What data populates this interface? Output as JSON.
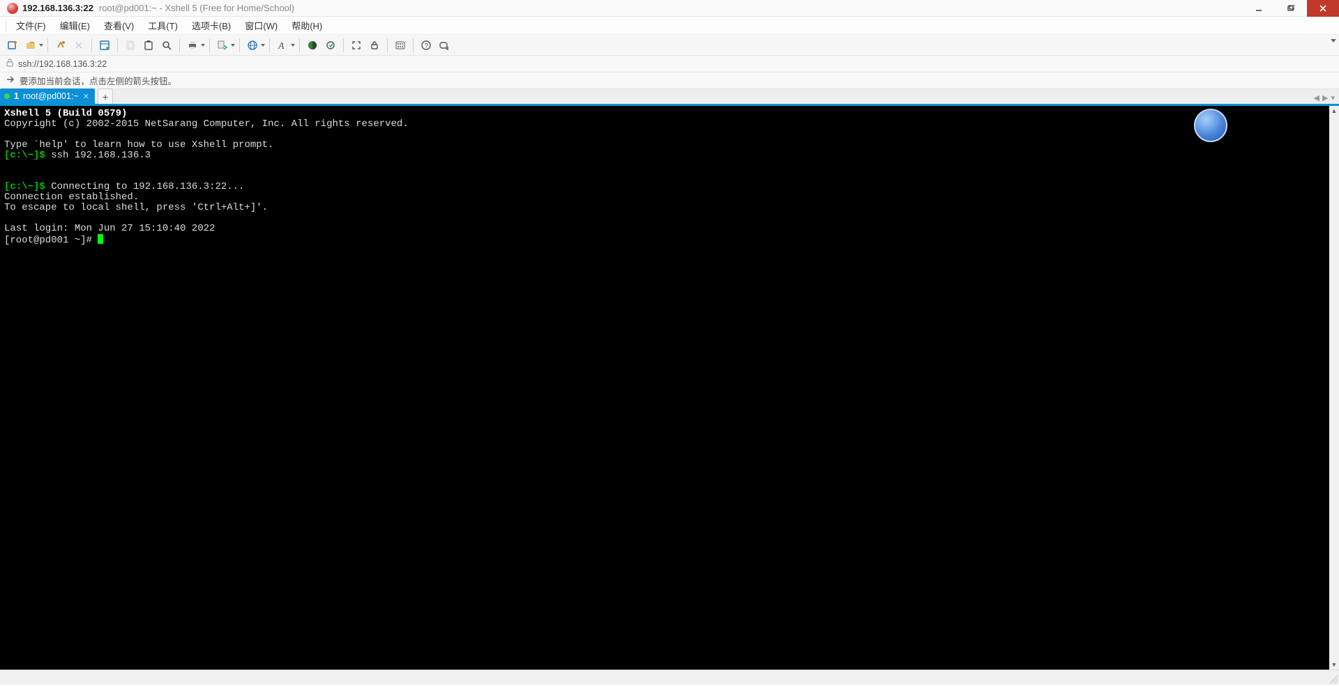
{
  "title": {
    "primary": "192.168.136.3:22",
    "secondary": "root@pd001:~ - Xshell 5 (Free for Home/School)"
  },
  "menu": {
    "file": "文件(F)",
    "edit": "编辑(E)",
    "view": "查看(V)",
    "tools": "工具(T)",
    "tabs": "选项卡(B)",
    "window": "窗口(W)",
    "help": "帮助(H)"
  },
  "toolbar_icons": {
    "new_session": "new-session-icon",
    "open": "open-icon",
    "reconnect": "reconnect-icon",
    "disconnect": "disconnect-icon",
    "properties": "properties-icon",
    "copy": "copy-icon",
    "paste": "paste-icon",
    "find": "find-icon",
    "print": "print-icon",
    "file_transfer": "file-transfer-icon",
    "encoding": "encoding-icon",
    "font": "font-icon",
    "color_scheme": "color-scheme-icon",
    "highlight": "highlight-icon",
    "fullscreen": "fullscreen-icon",
    "lock": "lock-icon",
    "keypad": "keypad-icon",
    "help": "help-icon",
    "compose": "compose-icon"
  },
  "address_bar": {
    "url": "ssh://192.168.136.3:22"
  },
  "info_bar": {
    "hint": "要添加当前会话，点击左侧的箭头按钮。"
  },
  "tab": {
    "index": "1",
    "label": "root@pd001:~",
    "add": "+"
  },
  "terminal": {
    "line_build": "Xshell 5 (Build 0579)",
    "line_copyright": "Copyright (c) 2002-2015 NetSarang Computer, Inc. All rights reserved.",
    "line_blank": "",
    "line_help": "Type `help' to learn how to use Xshell prompt.",
    "prompt_local": "[c:\\~]$",
    "cmd_ssh": " ssh 192.168.136.3",
    "line_connecting": " Connecting to 192.168.136.3:22...",
    "line_established": "Connection established.",
    "line_escape": "To escape to local shell, press 'Ctrl+Alt+]'.",
    "line_lastlogin": "Last login: Mon Jun 27 15:10:40 2022",
    "prompt_remote": "[root@pd001 ~]# "
  },
  "status": {
    "text": ""
  }
}
